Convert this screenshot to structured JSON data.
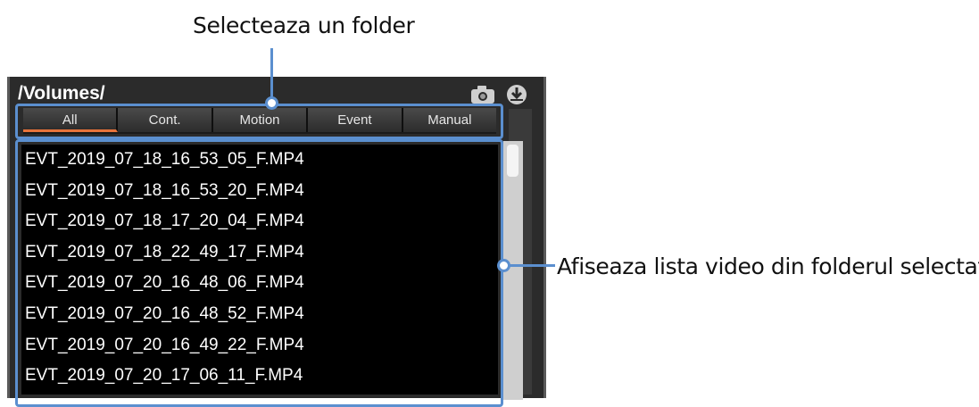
{
  "annotations": {
    "folder_select": "Selecteaza un folder",
    "video_list": "Afiseaza lista video din folderul selectat"
  },
  "player": {
    "path": "/Volumes/",
    "header_icons": [
      "camera-icon",
      "download-icon"
    ],
    "tabs": [
      {
        "label": "All",
        "active": true
      },
      {
        "label": "Cont.",
        "active": false
      },
      {
        "label": "Motion",
        "active": false
      },
      {
        "label": "Event",
        "active": false
      },
      {
        "label": "Manual",
        "active": false
      }
    ],
    "files": [
      "EVT_2019_07_18_16_53_05_F.MP4",
      "EVT_2019_07_18_16_53_20_F.MP4",
      "EVT_2019_07_18_17_20_04_F.MP4",
      "EVT_2019_07_18_22_49_17_F.MP4",
      "EVT_2019_07_20_16_48_06_F.MP4",
      "EVT_2019_07_20_16_48_52_F.MP4",
      "EVT_2019_07_20_16_49_22_F.MP4",
      "EVT_2019_07_20_17_06_11_F.MP4"
    ]
  },
  "colors": {
    "callout": "#5b8fcf",
    "active_tab_underline": "#e8733a",
    "list_background": "#000000"
  }
}
